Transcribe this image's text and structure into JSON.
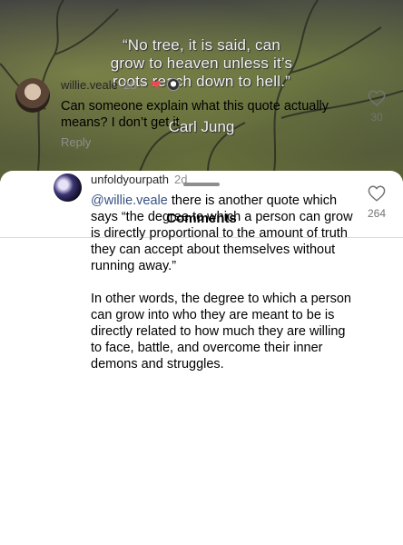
{
  "post": {
    "quote_lines": [
      "“No tree, it is said, can",
      "grow to heaven unless it’s",
      "roots reach down to hell.”"
    ],
    "author": "Carl Jung"
  },
  "sheet": {
    "title": "Comments"
  },
  "comments": [
    {
      "username": "willie.veale",
      "time": "2d",
      "separator": "•",
      "text": "Can someone explain what this quote actually means? I don’t get it",
      "reply_label": "Reply",
      "like_count": "30",
      "creator_liked": true
    },
    {
      "username": "unfoldyourpath",
      "time": "2d",
      "mention": "@willie.veale",
      "text_after_mention": " there is another quote which says “the degree to which a person can grow is directly proportional to the amount of truth they can accept about themselves without running away.”",
      "paragraph2": "In other words, the degree to which a person can grow into who they are meant to be is directly related to how much they are willing to face, battle, and overcome their inner demons and struggles.",
      "like_count": "264"
    }
  ],
  "colors": {
    "like_red": "#ed4956",
    "mention_blue": "#385185",
    "muted": "#8e8e8e"
  }
}
